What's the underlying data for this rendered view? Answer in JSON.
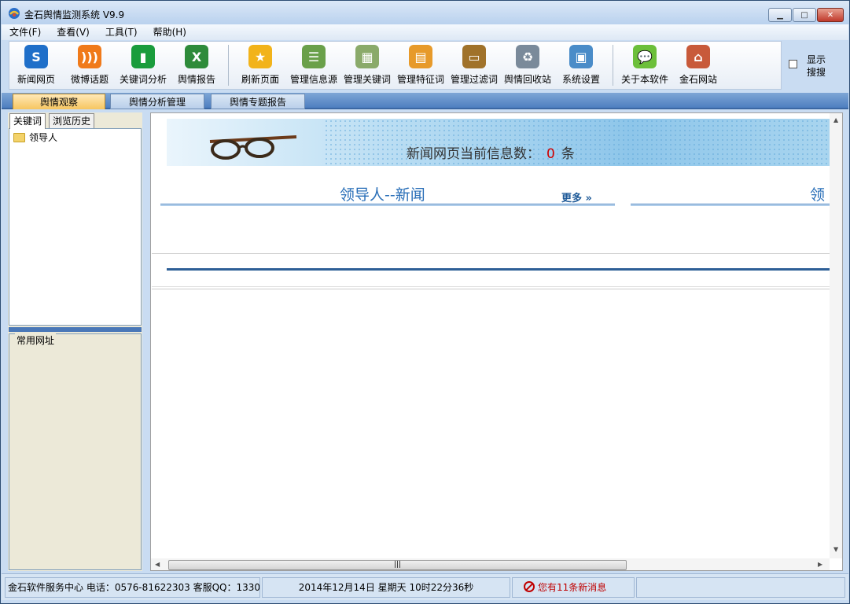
{
  "window": {
    "title": "金石舆情监测系统 V9.9"
  },
  "menu": [
    "文件(F)",
    "查看(V)",
    "工具(T)",
    "帮助(H)"
  ],
  "toolbar": [
    {
      "label": "新闻网页",
      "icon": "news-web-icon",
      "color": "#1f6fc9"
    },
    {
      "label": "微博话题",
      "icon": "rss-weibo-icon",
      "color": "#f07a1a"
    },
    {
      "label": "关键词分析",
      "icon": "bar-chart-icon",
      "color": "#1a9c3c"
    },
    {
      "label": "舆情报告",
      "icon": "excel-report-icon",
      "color": "#2e8b3a"
    },
    {
      "label": "刷新页面",
      "icon": "star-refresh-icon",
      "color": "#f2b31a"
    },
    {
      "label": "管理信息源",
      "icon": "cabinet-icon",
      "color": "#6aa04a"
    },
    {
      "label": "管理关键词",
      "icon": "table-grid-icon",
      "color": "#8aaa6a"
    },
    {
      "label": "管理特征词",
      "icon": "card-tag-icon",
      "color": "#e79a2a"
    },
    {
      "label": "管理过滤词",
      "icon": "folder-filter-icon",
      "color": "#a0722a"
    },
    {
      "label": "舆情回收站",
      "icon": "recycle-bin-icon",
      "color": "#7a8a9a"
    },
    {
      "label": "系统设置",
      "icon": "monitor-icon",
      "color": "#4a8cc8"
    },
    {
      "label": "关于本软件",
      "icon": "speech-bubble-icon",
      "color": "#6cbf3a"
    },
    {
      "label": "金石网站",
      "icon": "home-icon",
      "color": "#c85a3a"
    }
  ],
  "show_search": {
    "line1": "显示",
    "line2": "搜搜"
  },
  "main_tabs": [
    "舆情观察",
    "舆情分析管理",
    "舆情专题报告"
  ],
  "left": {
    "sub_tabs": [
      "关键词",
      "浏览历史"
    ],
    "tree_item": "领导人",
    "group_label": "常用网址"
  },
  "content": {
    "count_prefix": "新闻网页当前信息数：",
    "count_value": "0",
    "count_unit": "条",
    "section_title": "领导人--新闻",
    "more_label": "更多",
    "truncated_title": "领"
  },
  "status": {
    "service": "金石软件服务中心 电话：0576-81622303  客服QQ：1330",
    "datetime": "2014年12月14日   星期天    10时22分36秒",
    "message": "您有11条新消息"
  }
}
